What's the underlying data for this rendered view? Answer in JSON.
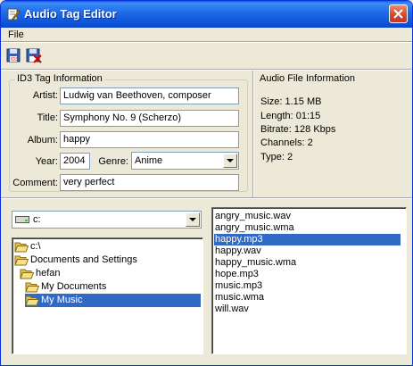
{
  "window": {
    "title": "Audio Tag Editor"
  },
  "menu": {
    "file": "File"
  },
  "toolbar": {
    "save_icon": "floppy-save-icon",
    "remove_icon": "tag-remove-icon"
  },
  "id3": {
    "group_label": "ID3 Tag Information",
    "artist_label": "Artist:",
    "artist": "Ludwig van Beethoven, composer",
    "title_label": "Title:",
    "title": "Symphony No. 9 (Scherzo)",
    "album_label": "Album:",
    "album": "happy",
    "year_label": "Year:",
    "year": "2004",
    "genre_label": "Genre:",
    "genre": "Anime",
    "comment_label": "Comment:",
    "comment": "very perfect"
  },
  "audio_info": {
    "group_label": "Audio File Information",
    "size": "Size:  1.15 MB",
    "length": "Length:  01:15",
    "bitrate": "Bitrate: 128 Kbps",
    "channels": "Channels:  2",
    "type": "Type:  2"
  },
  "drive": {
    "selected": "c:"
  },
  "directories": [
    "c:\\",
    "Documents and Settings",
    "hefan",
    "My Documents",
    "My Music"
  ],
  "selected_directory": "My Music",
  "files": [
    "angry_music.wav",
    "angry_music.wma",
    "happy.mp3",
    "happy.wav",
    "happy_music.wma",
    "hope.mp3",
    "music.mp3",
    "music.wma",
    "will.wav"
  ],
  "selected_file": "happy.mp3",
  "colors": {
    "title_bar": "#0b4fd6",
    "selection": "#316ac5",
    "window_bg": "#ece9d8"
  }
}
